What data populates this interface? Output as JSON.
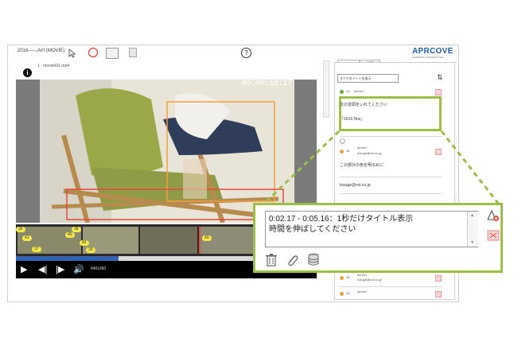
{
  "app": {
    "title": "2016-----.AVI (MOVIE)",
    "logo": "APRCOVE",
    "logo_sub": "COMMENT & REVIEW TOOL",
    "help": "?"
  },
  "video": {
    "filename": "1 - movie001.mp4",
    "timecode": "00:00:18:17",
    "size_label": "640x360",
    "progress": 0.34,
    "thumbnail_markers": [
      "35",
      "41",
      "40",
      "42",
      "37",
      "39",
      "38",
      "43"
    ]
  },
  "panel": {
    "tabs": [
      "ノート",
      "履歴"
    ],
    "filter": "すべてのノートを表示",
    "notes": [
      {
        "id": "10",
        "user": "demo1",
        "text": "文の冒頭をいれてください",
        "subtext": "「2016 Nov」"
      },
      {
        "id": "38",
        "user": "demo1",
        "email": "tosuge@vol.co.jp",
        "text": "この部分の色を明るめに",
        "subtext": "tosuge@vol.co.jp"
      },
      {
        "id": "40",
        "user": "demo1",
        "email": "tosuge@vol.co.jp"
      },
      {
        "id": "41",
        "user": "demo1"
      }
    ],
    "colors": {
      "green": "#6aaa3b",
      "orange": "#f0a13c"
    }
  },
  "callout": {
    "line1": "0:02.17 - 0:05.16：1秒だけタイトル表示",
    "line2": "時間を伸ばしてください",
    "actions": [
      "trash-icon",
      "paperclip-icon",
      "database-icon"
    ],
    "side": [
      "delete-note-icon",
      "resize-icon"
    ]
  },
  "colors": {
    "accent": "#9dbf4a",
    "brand": "#1f5fa8",
    "progress": "#3464b0",
    "marker": "#f4e74a"
  }
}
